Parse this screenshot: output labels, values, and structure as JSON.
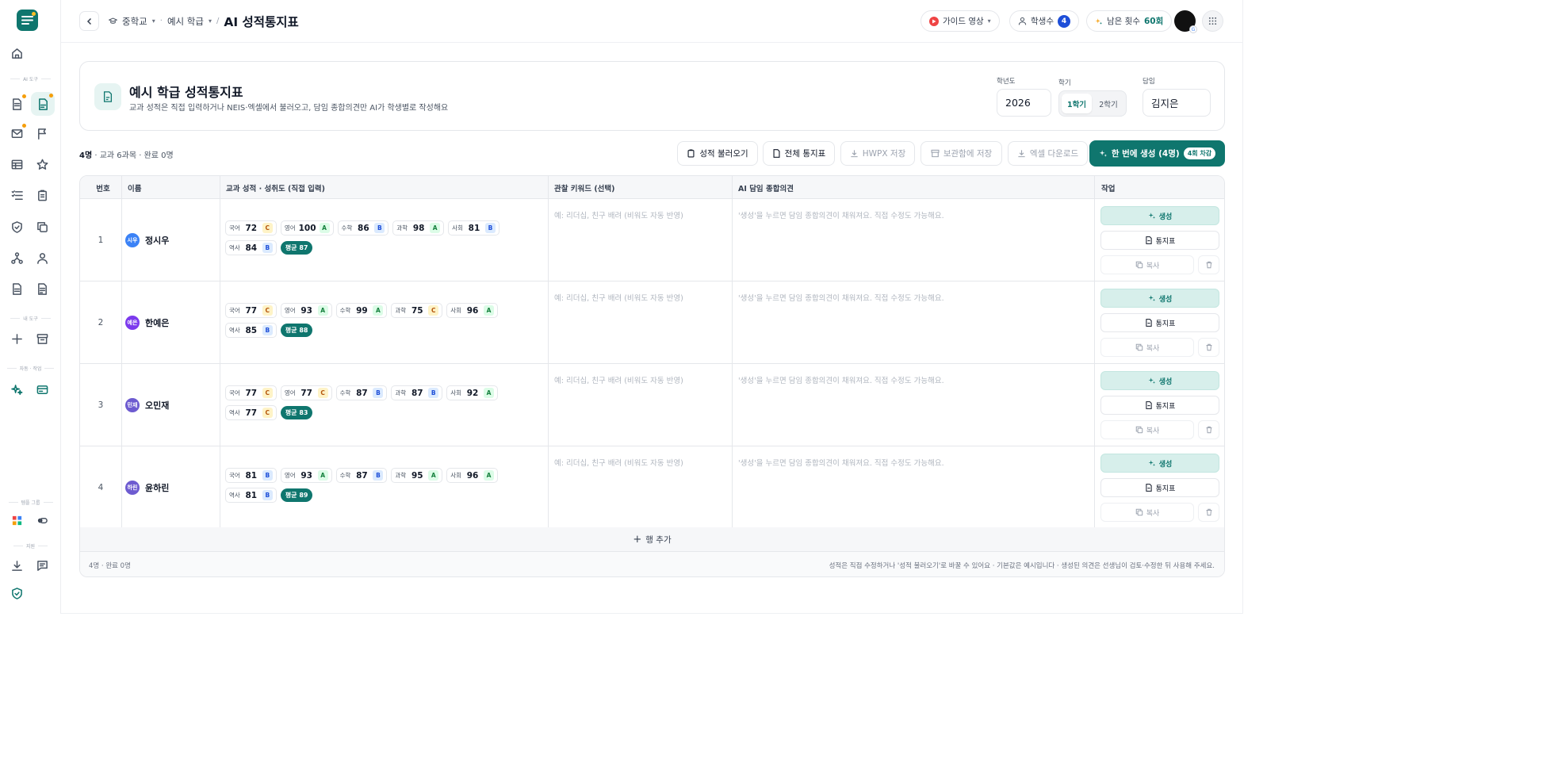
{
  "sidebar": {
    "sections": [
      "AI 도구",
      "내 도구",
      "자동 · 작업",
      "템플 그룹",
      "지원"
    ]
  },
  "topbar": {
    "crumbs": [
      "중학교",
      "예시 학급"
    ],
    "title": "AI 성적통지표",
    "guide_label": "가이드 영상",
    "students_label": "학생수",
    "students_count": "4",
    "remaining_label": "남은 횟수",
    "remaining_value": "60회"
  },
  "header": {
    "title": "예시 학급 성적통지표",
    "subtitle": "교과 성적은 직접 입력하거나 NEIS·엑셀에서 불러오고, 담임 종합의견만 AI가 학생별로 작성해요",
    "year_label": "학년도",
    "year_value": "2026",
    "semester_label": "학기",
    "semesters": [
      "1학기",
      "2학기"
    ],
    "teacher_label": "담임",
    "teacher_value": "김지은"
  },
  "toolbar": {
    "summary_count": "4명",
    "summary_rest": " · 교과 6과목 · 완료 0명",
    "import": "성적 불러오기",
    "full_report": "전체 통지표",
    "hwpx": "HWPX 저장",
    "archive": "보관함에 저장",
    "excel": "엑셀 다운로드",
    "generate_all": "한 번에 생성 (4명)",
    "generate_tag": "4회 차감"
  },
  "table": {
    "headers": [
      "번호",
      "이름",
      "교과 성적 · 성취도 (직접 입력)",
      "관찰 키워드 (선택)",
      "AI 담임 종합의견",
      "작업"
    ],
    "keyword_placeholder": "예: 리더십, 친구 배려 (비워도 자동 반영)",
    "opinion_placeholder": "'생성'을 누르면 담임 종합의견이 채워져요. 직접 수정도 가능해요.",
    "generate": "생성",
    "report": "통지표",
    "copy": "복사",
    "add_row": "행 추가",
    "footer_left": "4명 · 완료 0명",
    "footer_right": "성적은 직접 수정하거나 '성적 불러오기'로 바꿀 수 있어요 · 기본값은 예시입니다 · 생성된 의견은 선생님이 검토·수정한 뒤 사용해 주세요.",
    "rows": [
      {
        "num": "1",
        "name": "정시우",
        "initial": "시우",
        "color": "#3b82f6",
        "avg": "평균 87",
        "grades": [
          [
            "국어",
            "72",
            "C"
          ],
          [
            "영어",
            "100",
            "A"
          ],
          [
            "수학",
            "86",
            "B"
          ],
          [
            "과학",
            "98",
            "A"
          ],
          [
            "사회",
            "81",
            "B"
          ],
          [
            "역사",
            "84",
            "B"
          ]
        ]
      },
      {
        "num": "2",
        "name": "한예은",
        "initial": "예은",
        "color": "#7c3aed",
        "avg": "평균 88",
        "grades": [
          [
            "국어",
            "77",
            "C"
          ],
          [
            "영어",
            "93",
            "A"
          ],
          [
            "수학",
            "99",
            "A"
          ],
          [
            "과학",
            "75",
            "C"
          ],
          [
            "사회",
            "96",
            "A"
          ],
          [
            "역사",
            "85",
            "B"
          ]
        ]
      },
      {
        "num": "3",
        "name": "오민재",
        "initial": "민재",
        "color": "#6d5bd0",
        "avg": "평균 83",
        "grades": [
          [
            "국어",
            "77",
            "C"
          ],
          [
            "영어",
            "77",
            "C"
          ],
          [
            "수학",
            "87",
            "B"
          ],
          [
            "과학",
            "87",
            "B"
          ],
          [
            "사회",
            "92",
            "A"
          ],
          [
            "역사",
            "77",
            "C"
          ]
        ]
      },
      {
        "num": "4",
        "name": "윤하린",
        "initial": "하린",
        "color": "#6d5bd0",
        "avg": "평균 89",
        "grades": [
          [
            "국어",
            "81",
            "B"
          ],
          [
            "영어",
            "93",
            "A"
          ],
          [
            "수학",
            "87",
            "B"
          ],
          [
            "과학",
            "95",
            "A"
          ],
          [
            "사회",
            "96",
            "A"
          ],
          [
            "역사",
            "81",
            "B"
          ]
        ]
      }
    ]
  }
}
